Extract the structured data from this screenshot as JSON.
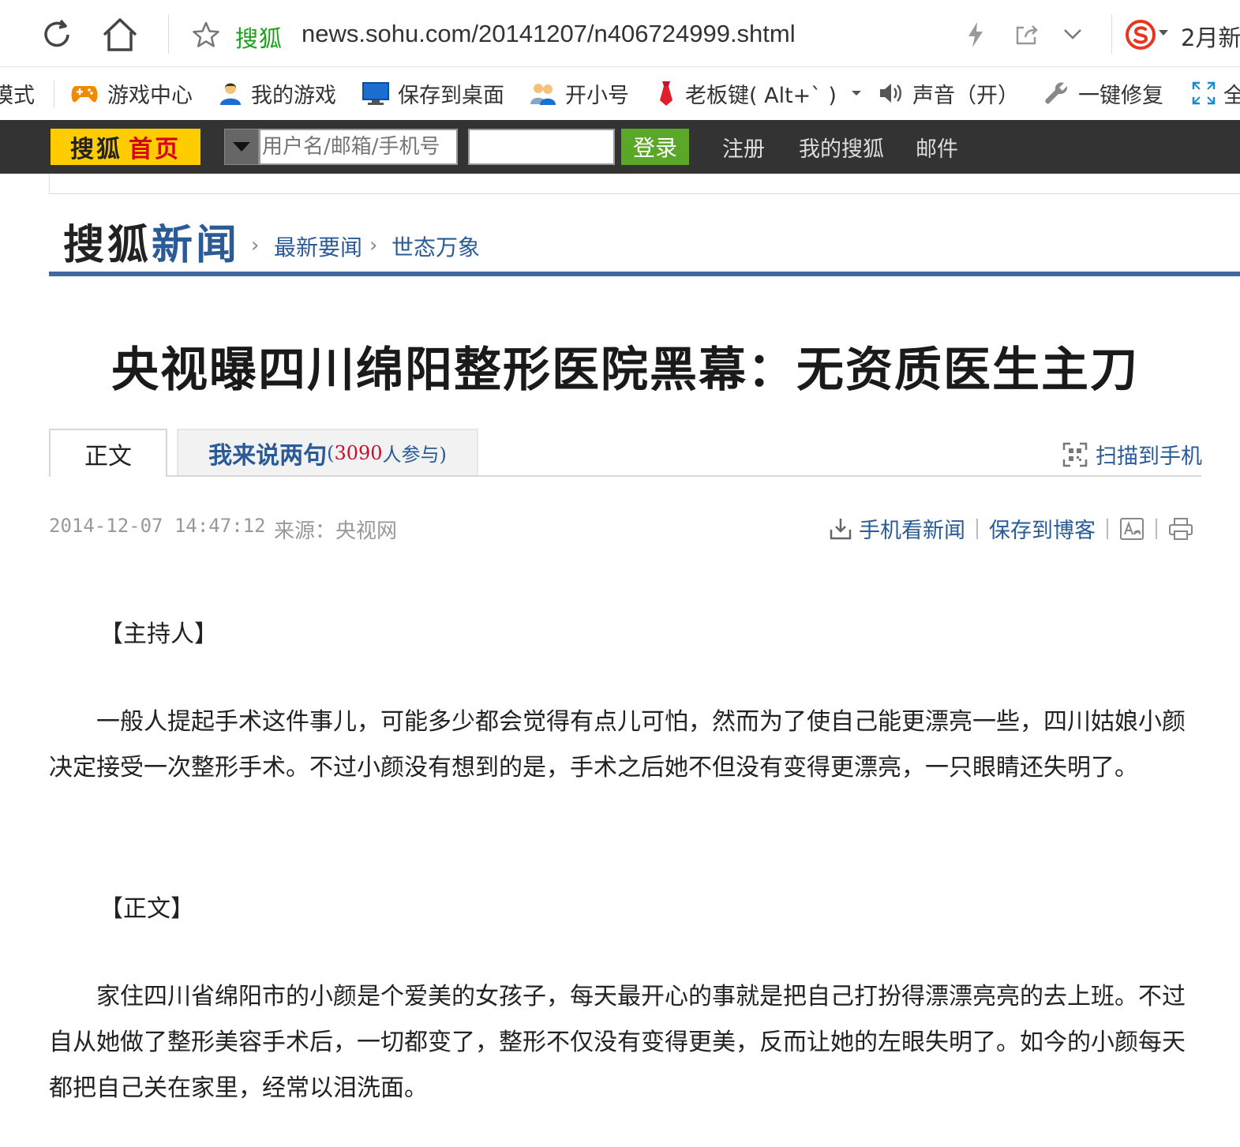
{
  "browser": {
    "site_name": "搜狐",
    "url": "news.sohu.com/20141207/n406724999.shtml",
    "right_text": "2月新"
  },
  "bookmarks": [
    {
      "label": "模式",
      "icon": "mode-icon"
    },
    {
      "label": "游戏中心",
      "icon": "gamepad-icon"
    },
    {
      "label": "我的游戏",
      "icon": "user-icon"
    },
    {
      "label": "保存到桌面",
      "icon": "monitor-icon"
    },
    {
      "label": "开小号",
      "icon": "users-icon"
    },
    {
      "label": "老板键( Alt+` )",
      "icon": "tie-icon"
    },
    {
      "label": "声音（开）",
      "icon": "speaker-icon"
    },
    {
      "label": "一键修复",
      "icon": "wrench-icon"
    },
    {
      "label": "全",
      "icon": "fullscreen-icon"
    }
  ],
  "sohu_bar": {
    "home_part1": "搜狐",
    "home_part2": "首页",
    "username_placeholder": "用户名/邮箱/手机号",
    "login": "登录",
    "links": [
      "注册",
      "我的搜狐",
      "邮件"
    ]
  },
  "header": {
    "logo_part1": "搜狐",
    "logo_part2": "新闻",
    "breadcrumb": [
      "最新要闻",
      "世态万象"
    ]
  },
  "article": {
    "title": "央视曝四川绵阳整形医院黑幕：无资质医生主刀",
    "tabs": {
      "body": "正文",
      "comment": "我来说两句",
      "comment_count_pre": "(",
      "comment_count": "3090",
      "comment_count_post": "人参与)"
    },
    "scan": "扫描到手机",
    "date": "2014-12-07 14:47:12",
    "source": "来源：央视网",
    "tools": [
      "手机看新闻",
      "保存到博客"
    ],
    "section1": "【主持人】",
    "para1": "一般人提起手术这件事儿，可能多少都会觉得有点儿可怕，然而为了使自己能更漂亮一些，四川姑娘小颜决定接受一次整形手术。不过小颜没有想到的是，手术之后她不但没有变得更漂亮，一只眼睛还失明了。",
    "section2": "【正文】",
    "para2": "家住四川省绵阳市的小颜是个爱美的女孩子，每天最开心的事就是把自己打扮得漂漂亮亮的去上班。不过自从她做了整形美容手术后，一切都变了，整形不仅没有变得更美，反而让她的左眼失明了。如今的小颜每天都把自己关在家里，经常以泪洗面。"
  },
  "colors": {
    "link_blue": "#2a5b96",
    "sohu_yellow": "#ffcc00",
    "sohu_red": "#d6001c",
    "login_green": "#5ba829",
    "bar_dark": "#333333",
    "site_green": "#1aa01a"
  }
}
